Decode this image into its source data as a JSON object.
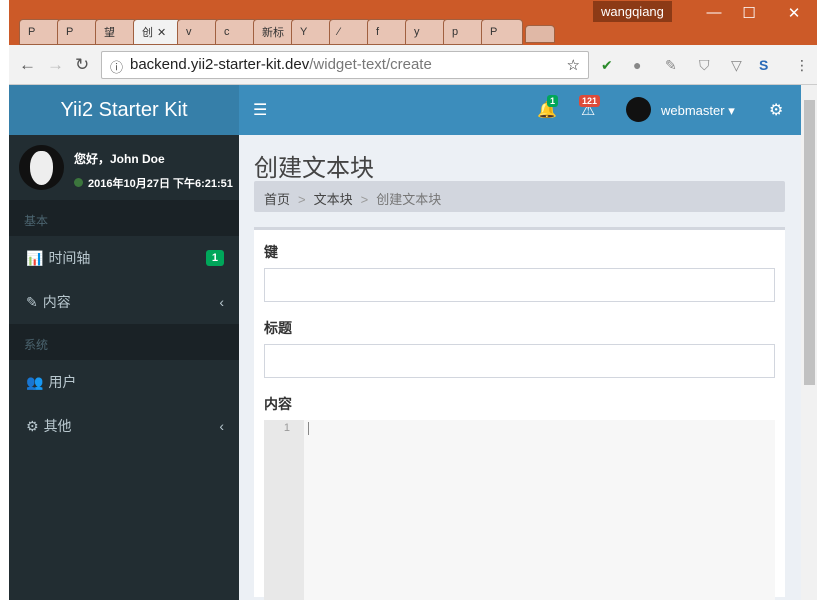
{
  "browser": {
    "profile": "wangqiang",
    "tabs": [
      "P",
      "P",
      "望",
      "创",
      "v",
      "c",
      "新标",
      "Y",
      "⁄",
      "f",
      "y",
      "p",
      "P"
    ],
    "url_host": "backend.yii2-starter-kit.dev",
    "url_path": "/widget-text/create"
  },
  "sidebar": {
    "logo": "Yii2 Starter Kit",
    "greeting": "您好，John Doe",
    "time": "2016年10月27日 下午6:21:51",
    "headers": [
      "基本",
      "系统"
    ],
    "items": [
      {
        "label": "时间轴",
        "badge": "1"
      },
      {
        "label": "内容"
      },
      {
        "label": "用户"
      },
      {
        "label": "其他"
      }
    ]
  },
  "topbar": {
    "notif_count": "1",
    "alert_count": "121",
    "user": "webmaster"
  },
  "main": {
    "title": "创建文本块",
    "breadcrumb": [
      "首页",
      "文本块",
      "创建文本块"
    ],
    "fields": {
      "key_label": "键",
      "title_label": "标题",
      "content_label": "内容",
      "key_value": "",
      "title_value": ""
    },
    "line_number": "1"
  }
}
